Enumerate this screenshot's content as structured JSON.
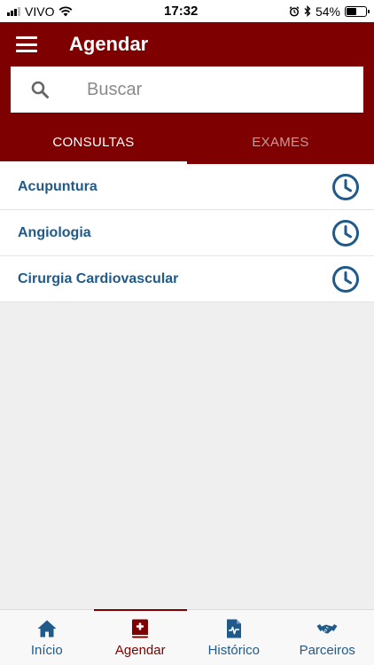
{
  "status_bar": {
    "carrier": "VIVO",
    "time": "17:32",
    "battery_percent": "54%",
    "battery_level": 0.54
  },
  "header": {
    "title": "Agendar",
    "menu_icon": "hamburger-menu-icon"
  },
  "search": {
    "placeholder": "Buscar",
    "icon": "search-icon"
  },
  "tabs": [
    {
      "label": "CONSULTAS",
      "active": true
    },
    {
      "label": "EXAMES",
      "active": false
    }
  ],
  "specialties": [
    {
      "label": "Acupuntura",
      "icon": "clock-icon"
    },
    {
      "label": "Angiologia",
      "icon": "clock-icon"
    },
    {
      "label": "Cirurgia Cardiovascular",
      "icon": "clock-icon"
    }
  ],
  "bottom_nav": [
    {
      "label": "Início",
      "icon": "home-icon",
      "active": false
    },
    {
      "label": "Agendar",
      "icon": "medical-book-icon",
      "active": true
    },
    {
      "label": "Histórico",
      "icon": "medical-file-icon",
      "active": false
    },
    {
      "label": "Parceiros",
      "icon": "handshake-icon",
      "active": false
    }
  ],
  "colors": {
    "primary": "#7e0000",
    "link_blue": "#1f5a8a",
    "background": "#efefef"
  }
}
